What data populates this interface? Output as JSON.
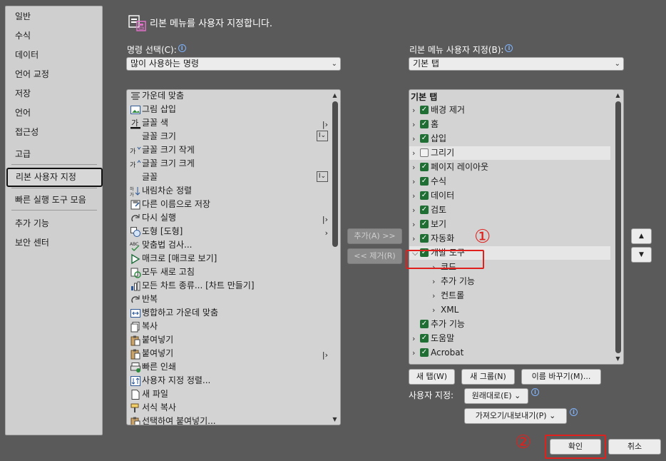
{
  "sidebar": {
    "items": [
      "일반",
      "수식",
      "데이터",
      "언어 교정",
      "저장",
      "언어",
      "접근성",
      "고급",
      "리본 사용자 지정",
      "빠른 실행 도구 모음",
      "추가 기능",
      "보안 센터"
    ],
    "selected_index": 8
  },
  "header": {
    "title": "리본 메뉴를 사용자 지정합니다."
  },
  "commands": {
    "label": "명령 선택(C):",
    "dropdown_value": "많이 사용하는 명령",
    "items": [
      {
        "label": "가운데 맞춤",
        "icon": "align-center-icon"
      },
      {
        "label": "그림 삽입",
        "icon": "insert-picture-icon"
      },
      {
        "label": "글꼴 색",
        "icon": "font-color-icon",
        "extra": "split"
      },
      {
        "label": "글꼴 크기",
        "icon": "",
        "extra": "box"
      },
      {
        "label": "글꼴 크기 작게",
        "icon": "decrease-font-icon"
      },
      {
        "label": "글꼴 크기 크게",
        "icon": "increase-font-icon"
      },
      {
        "label": "글꼴",
        "icon": "",
        "extra": "box"
      },
      {
        "label": "내림차순 정렬",
        "icon": "sort-descending-icon"
      },
      {
        "label": "다른 이름으로 저장",
        "icon": "save-as-icon"
      },
      {
        "label": "다시 실행",
        "icon": "redo-icon",
        "extra": "split"
      },
      {
        "label": "도형 [도형]",
        "icon": "shapes-icon",
        "extra": "arrow"
      },
      {
        "label": "맞춤법 검사...",
        "icon": "spelling-icon"
      },
      {
        "label": "매크로 [매크로 보기]",
        "icon": "macro-icon"
      },
      {
        "label": "모두 새로 고침",
        "icon": "refresh-all-icon"
      },
      {
        "label": "모든 차트 종류... [차트 만들기]",
        "icon": "chart-icon"
      },
      {
        "label": "반복",
        "icon": "repeat-icon"
      },
      {
        "label": "병합하고 가운데 맞춤",
        "icon": "merge-center-icon"
      },
      {
        "label": "복사",
        "icon": "copy-icon"
      },
      {
        "label": "붙여넣기",
        "icon": "paste-icon"
      },
      {
        "label": "붙여넣기",
        "icon": "paste-icon",
        "extra": "split"
      },
      {
        "label": "빠른 인쇄",
        "icon": "quick-print-icon"
      },
      {
        "label": "사용자 지정 정렬...",
        "icon": "custom-sort-icon"
      },
      {
        "label": "새 파일",
        "icon": "new-file-icon"
      },
      {
        "label": "서식 복사",
        "icon": "format-painter-icon"
      },
      {
        "label": "선택하여 붙여넣기...",
        "icon": "paste-special-icon"
      }
    ]
  },
  "middle_buttons": {
    "add": "추가(A) >>",
    "remove": "<< 제거(R)"
  },
  "ribbon": {
    "label": "리본 메뉴 사용자 지정(B):",
    "dropdown_value": "기본 탭",
    "tree_header": "기본 탭",
    "items": [
      {
        "label": "배경 제거",
        "level": 1,
        "checked": true,
        "twisty": "collapsed"
      },
      {
        "label": "홈",
        "level": 1,
        "checked": true,
        "twisty": "collapsed"
      },
      {
        "label": "삽입",
        "level": 1,
        "checked": true,
        "twisty": "collapsed"
      },
      {
        "label": "그리기",
        "level": 1,
        "checked": false,
        "twisty": "collapsed",
        "highlight": true
      },
      {
        "label": "페이지 레이아웃",
        "level": 1,
        "checked": true,
        "twisty": "collapsed"
      },
      {
        "label": "수식",
        "level": 1,
        "checked": true,
        "twisty": "collapsed"
      },
      {
        "label": "데이터",
        "level": 1,
        "checked": true,
        "twisty": "collapsed"
      },
      {
        "label": "검토",
        "level": 1,
        "checked": true,
        "twisty": "collapsed"
      },
      {
        "label": "보기",
        "level": 1,
        "checked": true,
        "twisty": "collapsed"
      },
      {
        "label": "자동화",
        "level": 1,
        "checked": true,
        "twisty": "collapsed"
      },
      {
        "label": "개발 도구",
        "level": 1,
        "checked": true,
        "twisty": "expanded",
        "highlight": true
      },
      {
        "label": "코드",
        "level": 2,
        "checked": null,
        "twisty": "collapsed"
      },
      {
        "label": "추가 기능",
        "level": 2,
        "checked": null,
        "twisty": "collapsed"
      },
      {
        "label": "컨트롤",
        "level": 2,
        "checked": null,
        "twisty": "collapsed"
      },
      {
        "label": "XML",
        "level": 2,
        "checked": null,
        "twisty": "collapsed"
      },
      {
        "label": "추가 기능",
        "level": 1,
        "checked": true,
        "twisty": "none"
      },
      {
        "label": "도움말",
        "level": 1,
        "checked": true,
        "twisty": "collapsed"
      },
      {
        "label": "Acrobat",
        "level": 1,
        "checked": true,
        "twisty": "collapsed"
      }
    ]
  },
  "ribbon_buttons": {
    "new_tab": "새 탭(W)",
    "new_group": "새 그룹(N)",
    "rename": "이름 바꾸기(M)..."
  },
  "customize": {
    "label": "사용자 지정:",
    "reset": "원래대로(E)",
    "import_export": "가져오기/내보내기(P)"
  },
  "footer": {
    "ok": "확인",
    "cancel": "취소"
  },
  "annotations": {
    "one": "①",
    "two": "②"
  },
  "colors": {
    "background": "#5a5a5a",
    "panel": "#d3d3d3",
    "check_green": "#1f6f35",
    "annotation_red": "#e0201d"
  }
}
